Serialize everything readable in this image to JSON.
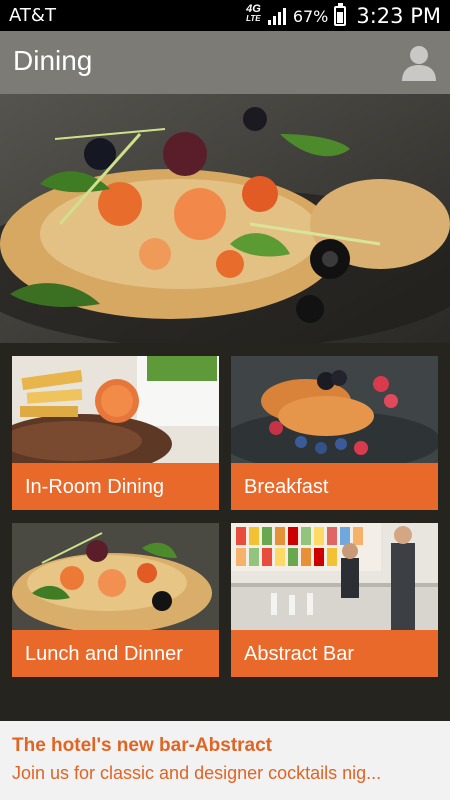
{
  "status_bar": {
    "carrier": "AT&T",
    "network_type": "4G",
    "network_sub": "LTE",
    "battery_percent": "67%",
    "battery_level": 0.67,
    "time": "3:23 PM"
  },
  "app_bar": {
    "title": "Dining",
    "profile_icon": "person-icon"
  },
  "tiles": [
    {
      "label": "In-Room Dining"
    },
    {
      "label": "Breakfast"
    },
    {
      "label": "Lunch and Dinner"
    },
    {
      "label": "Abstract Bar"
    }
  ],
  "banner": {
    "headline": "The hotel's new bar-Abstract",
    "text": "Join us for classic and designer cocktails nig..."
  },
  "colors": {
    "accent": "#e8692a",
    "app_bar": "#7c7b76",
    "background": "#26241f",
    "banner_text": "#e06423"
  }
}
